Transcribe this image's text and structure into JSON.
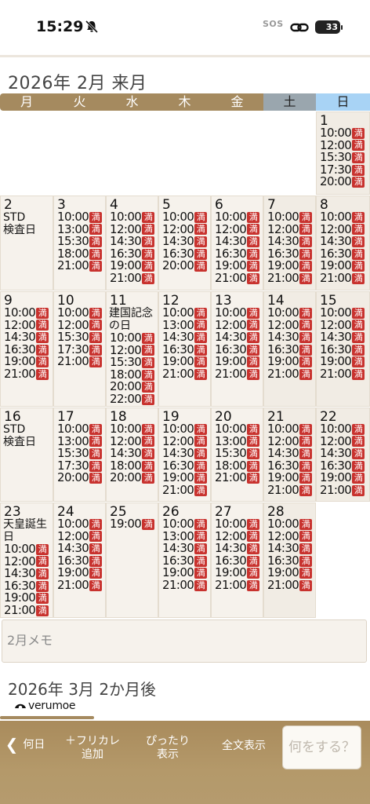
{
  "status": {
    "time": "15:29",
    "sos": "SOS",
    "battery": "33"
  },
  "month": {
    "title": "2026年 2月 来月"
  },
  "weekdays": [
    "月",
    "火",
    "水",
    "木",
    "金",
    "土",
    "日"
  ],
  "colors": {
    "brand": "#a58a5f",
    "full_badge": "#c8322e",
    "saturday": "#9aa6ae",
    "sunday": "#a8d3f5"
  },
  "calendar": {
    "weeks": [
      [
        null,
        null,
        null,
        null,
        null,
        null,
        {
          "day": "1",
          "slots": [
            "10:00",
            "12:00",
            "15:30",
            "17:30",
            "20:00"
          ]
        }
      ],
      [
        {
          "day": "2",
          "note": "STD\n検査日",
          "slots": []
        },
        {
          "day": "3",
          "slots": [
            "10:00",
            "13:00",
            "15:30",
            "18:00",
            "21:00"
          ]
        },
        {
          "day": "4",
          "slots": [
            "10:00",
            "12:00",
            "14:30",
            "16:30",
            "19:00",
            "21:00"
          ]
        },
        {
          "day": "5",
          "slots": [
            "10:00",
            "12:00",
            "14:30",
            "16:30",
            "20:00"
          ]
        },
        {
          "day": "6",
          "slots": [
            "10:00",
            "12:00",
            "14:30",
            "16:30",
            "19:00",
            "21:00"
          ]
        },
        {
          "day": "7",
          "slots": [
            "10:00",
            "12:00",
            "14:30",
            "16:30",
            "19:00",
            "21:00"
          ]
        },
        {
          "day": "8",
          "slots": [
            "10:00",
            "12:00",
            "14:30",
            "16:30",
            "19:00",
            "21:00"
          ]
        }
      ],
      [
        {
          "day": "9",
          "slots": [
            "10:00",
            "12:00",
            "14:30",
            "16:30",
            "19:00",
            "21:00"
          ]
        },
        {
          "day": "10",
          "slots": [
            "10:00",
            "12:00",
            "15:30",
            "17:30",
            "21:00"
          ]
        },
        {
          "day": "11",
          "note": "建国記念\nの日",
          "slots": [
            "10:00",
            "12:00",
            "15:30",
            "18:00",
            "20:00",
            "22:00"
          ]
        },
        {
          "day": "12",
          "slots": [
            "10:00",
            "13:00",
            "14:30",
            "16:30",
            "19:00",
            "21:00"
          ]
        },
        {
          "day": "13",
          "slots": [
            "10:00",
            "12:00",
            "14:30",
            "16:30",
            "19:00",
            "21:00"
          ]
        },
        {
          "day": "14",
          "slots": [
            "10:00",
            "12:00",
            "14:30",
            "16:30",
            "19:00",
            "21:00"
          ]
        },
        {
          "day": "15",
          "slots": [
            "10:00",
            "12:00",
            "14:30",
            "16:30",
            "19:00",
            "21:00"
          ]
        }
      ],
      [
        {
          "day": "16",
          "note": "STD\n検査日",
          "slots": []
        },
        {
          "day": "17",
          "slots": [
            "10:00",
            "13:00",
            "15:30",
            "17:30",
            "20:00"
          ]
        },
        {
          "day": "18",
          "slots": [
            "10:00",
            "12:00",
            "14:30",
            "18:00",
            "20:00"
          ]
        },
        {
          "day": "19",
          "slots": [
            "10:00",
            "12:00",
            "14:30",
            "16:30",
            "19:00",
            "21:00"
          ]
        },
        {
          "day": "20",
          "slots": [
            "10:00",
            "13:00",
            "15:30",
            "18:00",
            "21:00"
          ]
        },
        {
          "day": "21",
          "slots": [
            "10:00",
            "12:00",
            "14:30",
            "16:30",
            "19:00",
            "21:00"
          ]
        },
        {
          "day": "22",
          "slots": [
            "10:00",
            "12:00",
            "14:30",
            "16:30",
            "19:00",
            "21:00"
          ]
        }
      ],
      [
        {
          "day": "23",
          "note": "天皇誕生\n日",
          "slots": [
            "10:00",
            "12:00",
            "14:30",
            "16:30",
            "19:00",
            "21:00"
          ]
        },
        {
          "day": "24",
          "slots": [
            "10:00",
            "12:00",
            "14:30",
            "16:30",
            "19:00",
            "21:00"
          ]
        },
        {
          "day": "25",
          "slots": [
            "19:00"
          ]
        },
        {
          "day": "26",
          "slots": [
            "10:00",
            "13:00",
            "14:30",
            "16:30",
            "19:00",
            "21:00"
          ]
        },
        {
          "day": "27",
          "slots": [
            "10:00",
            "12:00",
            "14:30",
            "16:30",
            "19:00",
            "21:00"
          ]
        },
        {
          "day": "28",
          "slots": [
            "10:00",
            "12:00",
            "14:30",
            "16:30",
            "19:00",
            "21:00"
          ]
        },
        null
      ]
    ],
    "full_mark": "満"
  },
  "memo": {
    "label": "2月メモ"
  },
  "next_month": {
    "title": "2026年 3月 2か月後"
  },
  "brand": {
    "logo_text": "verumoe"
  },
  "toolbar": {
    "back": "何日",
    "furigana_line1": "＋フリカレ",
    "furigana_line2": "追加",
    "fit_line1": "ぴったり",
    "fit_line2": "表示",
    "full_text": "全文表示",
    "action": "何をする？"
  }
}
